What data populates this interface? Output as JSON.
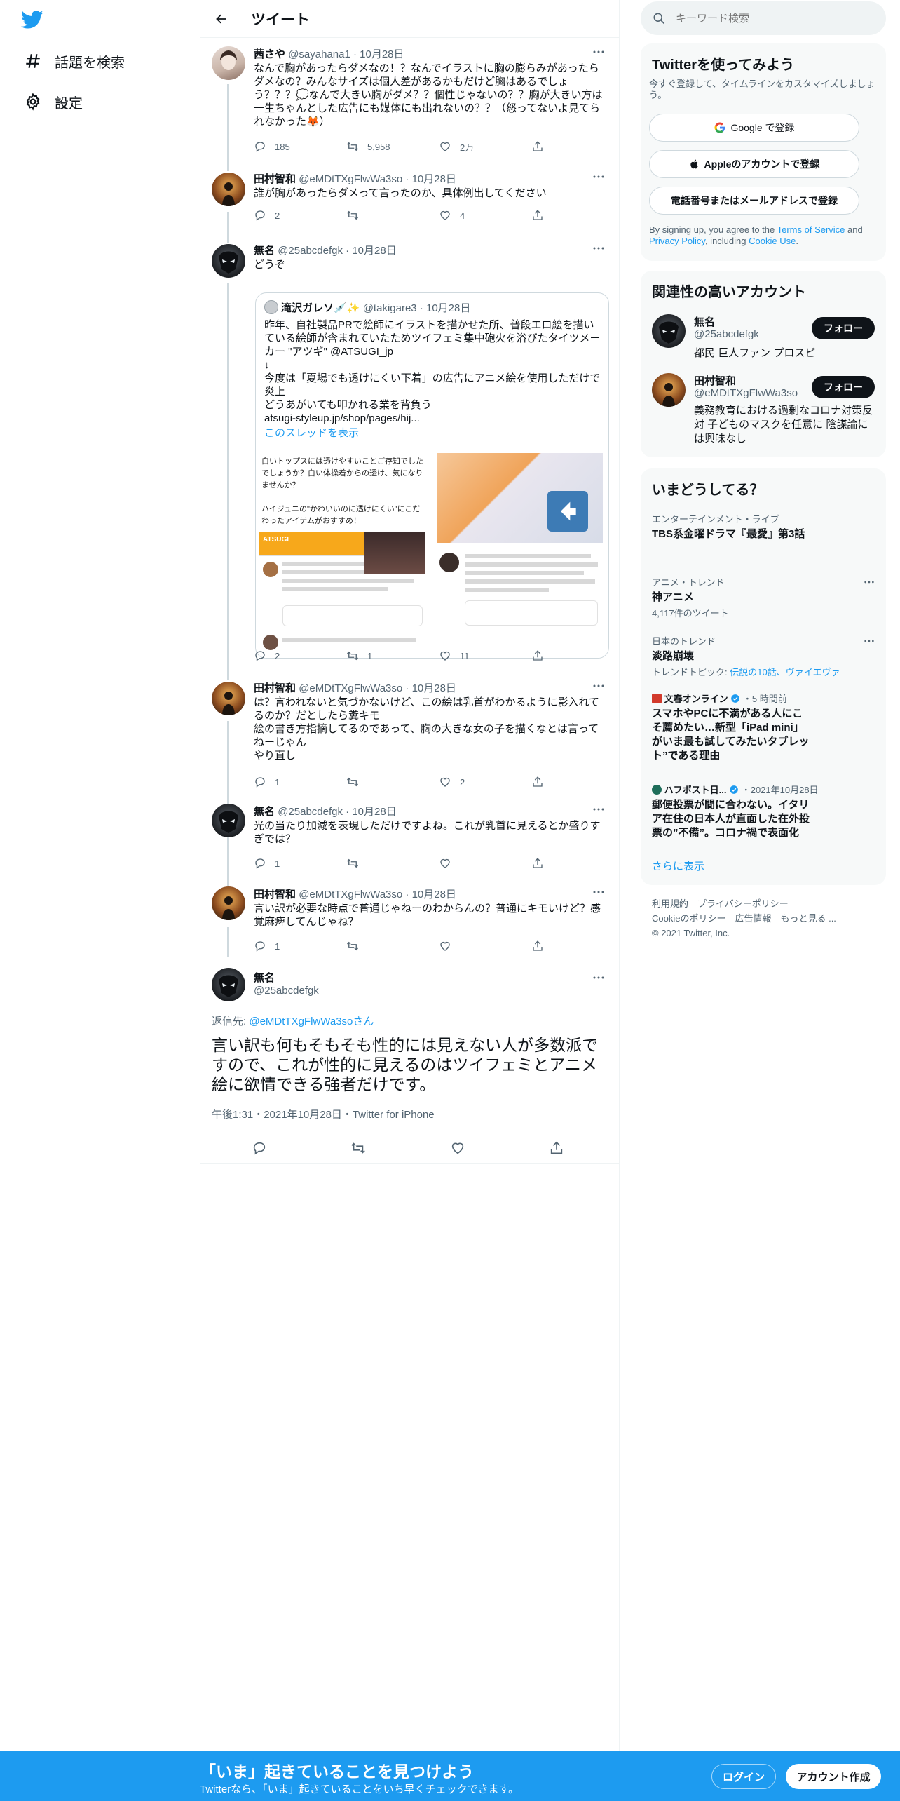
{
  "nav": {
    "explore_label": "話題を検索",
    "settings_label": "設定"
  },
  "header": {
    "title": "ツイート"
  },
  "tweets": [
    {
      "name": "茜さや",
      "handle": "@sayahana1",
      "date": "10月28日",
      "text": "なんで胸があったらダメなの！？なんでイラストに胸の膨らみがあったらダメなの？みんなサイズは個人差があるかもだけど胸はあるでしょう？？？💭なんで大きい胸がダメ？？個性じゃないの？？胸が大きい方は一生ちゃんとした広告にも媒体にも出れないの？？（怒ってないよ見てられなかった🦊）",
      "replies": "185",
      "retweets": "5,958",
      "likes": "2万"
    },
    {
      "name": "田村智和",
      "handle": "@eMDtTXgFlwWa3so",
      "date": "10月28日",
      "text": "誰が胸があったらダメって言ったのか、具体例出してください",
      "replies": "2",
      "retweets": "",
      "likes": "4"
    },
    {
      "name": "無名",
      "handle": "@25abcdefgk",
      "date": "10月28日",
      "text": "どうぞ",
      "replies": "2",
      "retweets": "1",
      "likes": "11",
      "quote": {
        "name": "滝沢ガレソ💉✨",
        "handle": "@takigare3",
        "date": "10月28日",
        "text": "昨年、自社製品PRで絵師にイラストを描かせた所、普段エロ絵を描いている絵師が含まれていたためツイフェミ集中砲火を浴びたタイツメーカー \"アツギ\" @ATSUGI_jp\n↓\n今度は「夏場でも透けにくい下着」の広告にアニメ絵を使用しただけで炎上\nどうあがいても叩かれる業を背負う\natsugi-styleup.jp/shop/pages/hij...",
        "show_thread": "このスレッドを表示",
        "media_text": "白いトップスには透けやすいことご存知でしたでしょうか？白い体操着からの透け、気になりませんか？\n\nハイジュニの\"かわいいのに透けにくい\"にこだわったアイテムがおすすめ！",
        "media_brand": "ATSUGI"
      }
    },
    {
      "name": "田村智和",
      "handle": "@eMDtTXgFlwWa3so",
      "date": "10月28日",
      "text": "は？言われないと気づかないけど、この絵は乳首がわかるように影入れてるのか？だとしたら糞キモ\n絵の書き方指摘してるのであって、胸の大きな女の子を描くなとは言ってねーじゃん\nやり直し",
      "replies": "1",
      "retweets": "",
      "likes": "2"
    },
    {
      "name": "無名",
      "handle": "@25abcdefgk",
      "date": "10月28日",
      "text": "光の当たり加減を表現しただけですよね。これが乳首に見えるとか盛りすぎでは？",
      "replies": "1",
      "retweets": "",
      "likes": ""
    },
    {
      "name": "田村智和",
      "handle": "@eMDtTXgFlwWa3so",
      "date": "10月28日",
      "text": "言い訳が必要な時点で普通じゃねーのわからんの？普通にキモいけど？感覚麻痺してんじゃね？",
      "replies": "1",
      "retweets": "",
      "likes": ""
    }
  ],
  "focal": {
    "name": "無名",
    "handle": "@25abcdefgk",
    "reply_prefix": "返信先: ",
    "reply_to": "@eMDtTXgFlwWa3soさん",
    "text": "言い訳も何もそもそも性的には見えない人が多数派ですので、これが性的に見えるのはツイフェミとアニメ絵に欲情できる強者だけです。",
    "meta": "午後1:31・2021年10月28日・Twitter for iPhone"
  },
  "sidebar": {
    "search_placeholder": "キーワード検索",
    "signup": {
      "title": "Twitterを使ってみよう",
      "subtitle": "今すぐ登録して、タイムラインをカスタマイズしましょう。",
      "google": "Google で登録",
      "apple": "Appleのアカウントで登録",
      "phone": "電話番号またはメールアドレスで登録",
      "legal_pre": "By signing up, you agree to the ",
      "terms": "Terms of Service",
      "and": " and ",
      "privacy": "Privacy Policy",
      "including": ", including ",
      "cookie": "Cookie Use",
      "period": "."
    },
    "relevant": {
      "title": "関連性の高いアカウント",
      "follow": "フォロー",
      "accounts": [
        {
          "name": "無名",
          "handle": "@25abcdefgk",
          "bio": "都民 巨人ファン プロスピ"
        },
        {
          "name": "田村智和",
          "handle": "@eMDtTXgFlwWa3so",
          "bio": "義務教育における過剰なコロナ対策反対 子どものマスクを任意に 陰謀論には興味なし"
        }
      ]
    },
    "trends": {
      "title": "いまどうしてる？",
      "t1_ctx": "エンターテインメント・ライブ",
      "t1_title": "TBS系金曜ドラマ『最愛』第3話",
      "t2_ctx": "アニメ・トレンド",
      "t2_title": "神アニメ",
      "t2_count": "4,117件のツイート",
      "t3_ctx": "日本のトレンド",
      "t3_title": "淡路崩壊",
      "t3_related_pre": "トレンドトピック: ",
      "t3_related": "伝説の10話、ヴァイエヴァ",
      "n1_source": "文春オンライン",
      "n1_time": "・5 時間前",
      "n1_title": "スマホやPCに不満がある人にこそ薦めたい…新型「iPad mini」がいま最も試してみたいタブレット”である理由",
      "n2_source": "ハフポスト日...",
      "n2_time": "・2021年10月28日",
      "n2_title": "郵便投票が間に合わない。イタリア在住の日本人が直面した在外投票の”不備”。コロナ禍で表面化",
      "more": "さらに表示"
    },
    "footer": {
      "line1": "利用規約　プライバシーポリシー",
      "line2": "Cookieのポリシー　広告情報　もっと見る ...",
      "line3": "© 2021 Twitter, Inc."
    }
  },
  "banner": {
    "title": "「いま」起きていることを見つけよう",
    "subtitle": "Twitterなら、「いま」起きていることをいち早くチェックできます。",
    "login": "ログイン",
    "signup": "アカウント作成"
  },
  "colors": {
    "accent": "#1d9bf0",
    "text": "#0f1419",
    "muted": "#536471"
  }
}
